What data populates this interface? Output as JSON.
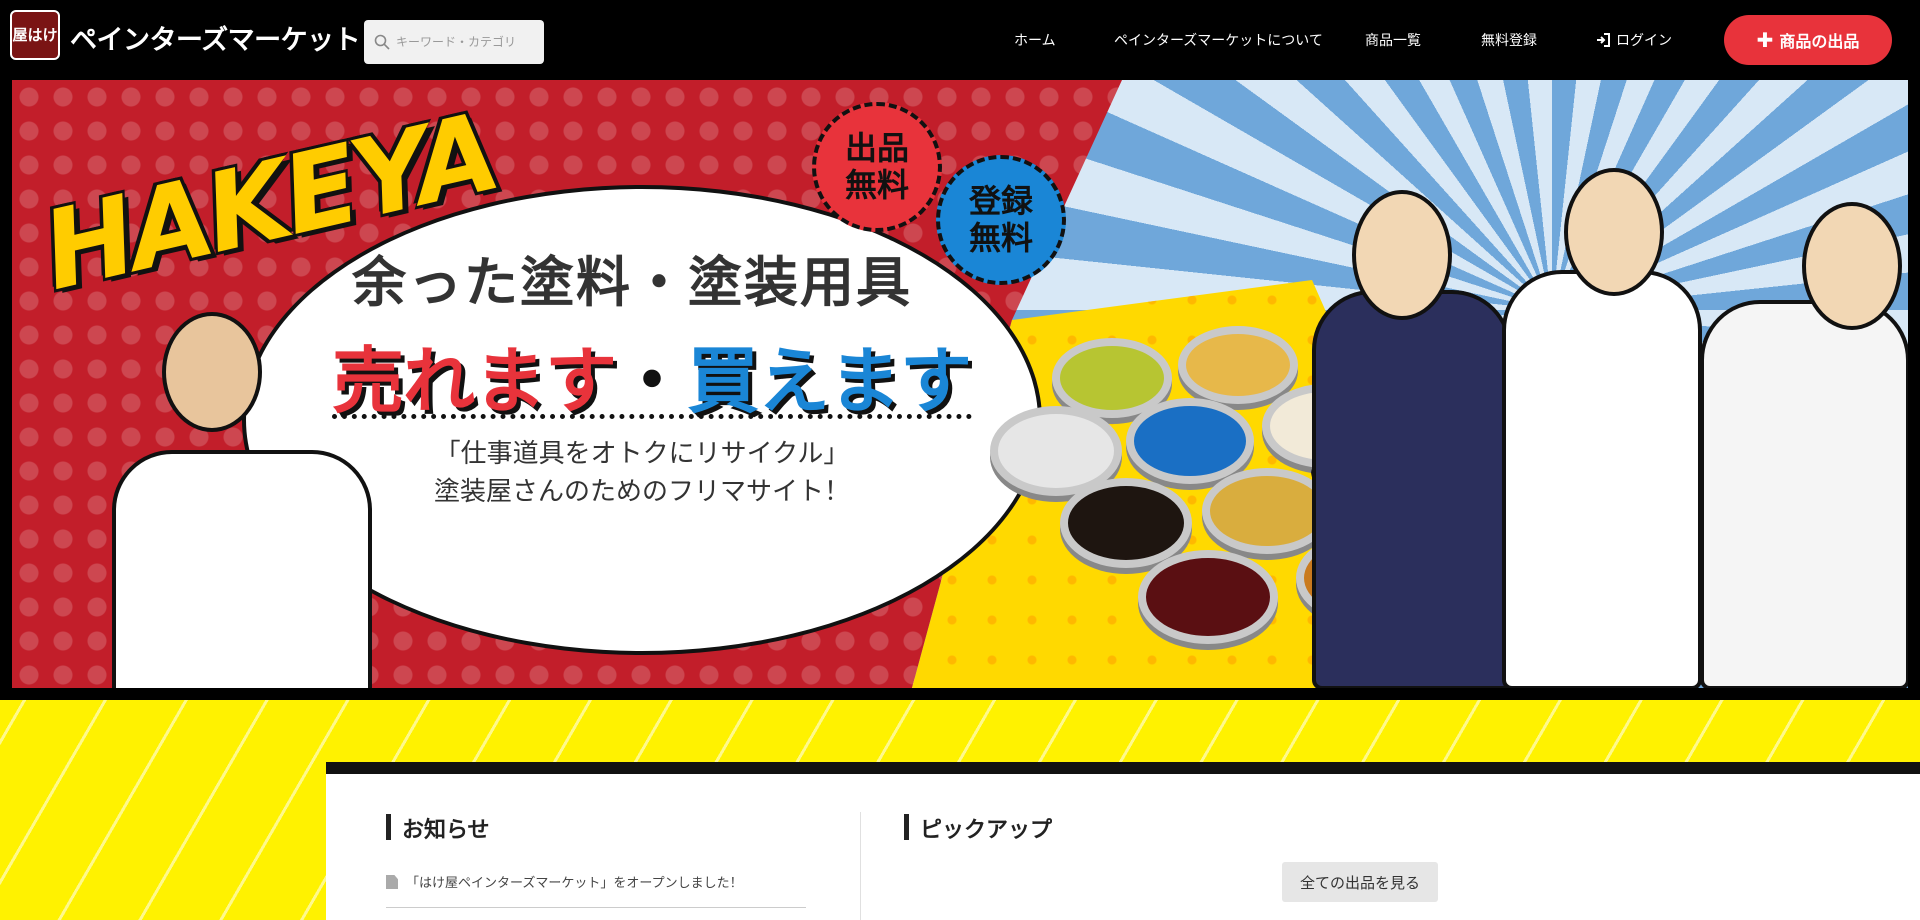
{
  "header": {
    "logo_text": "屋はけ",
    "site_title": "ペインターズマーケット",
    "search_placeholder": "キーワード・カテゴリ",
    "nav": [
      "ホーム",
      "ペインターズマーケットについて",
      "商品一覧",
      "無料登録",
      "ログイン"
    ],
    "sell_button": "商品の出品"
  },
  "banner": {
    "logo": "HAKEYA",
    "badge_red": "出品\n無料",
    "badge_blue": "登録\n無料",
    "headline": "余った塗料・塗装用具",
    "sell": "売れます",
    "dot": "・",
    "buy": "買えます",
    "tagline1": "「仕事道具をオトクにリサイクル」",
    "tagline2": "塗装屋さんのためのフリマサイト！"
  },
  "news": {
    "title": "お知らせ",
    "items": [
      "「はけ屋ペインターズマーケット」をオープンしました！"
    ]
  },
  "pickup": {
    "title": "ピックアップ",
    "all_button": "全ての出品を見る"
  },
  "colors": {
    "accent_red": "#e8333b",
    "accent_blue": "#1a86d6",
    "yellow": "#fff200"
  }
}
